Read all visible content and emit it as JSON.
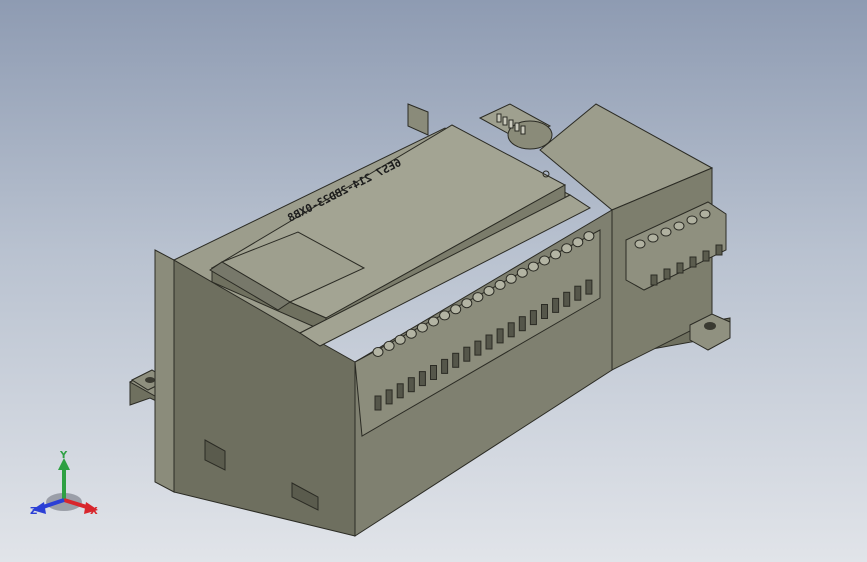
{
  "model": {
    "part_number_label": "6ES7 214-2BD23-0XB8",
    "front_terminal_count": 20,
    "side_terminal_count": 6
  },
  "triad": {
    "x_label": "X",
    "y_label": "Y",
    "z_label": "Z",
    "x_color": "#d8262c",
    "y_color": "#2ea043",
    "z_color": "#2b3fd6"
  },
  "colors": {
    "background_top": "#8e9bb2",
    "background_bottom": "#e1e4e9",
    "body_light": "#9a9b8a",
    "body_mid": "#7d7e6d",
    "body_dark": "#5c5d4f"
  }
}
